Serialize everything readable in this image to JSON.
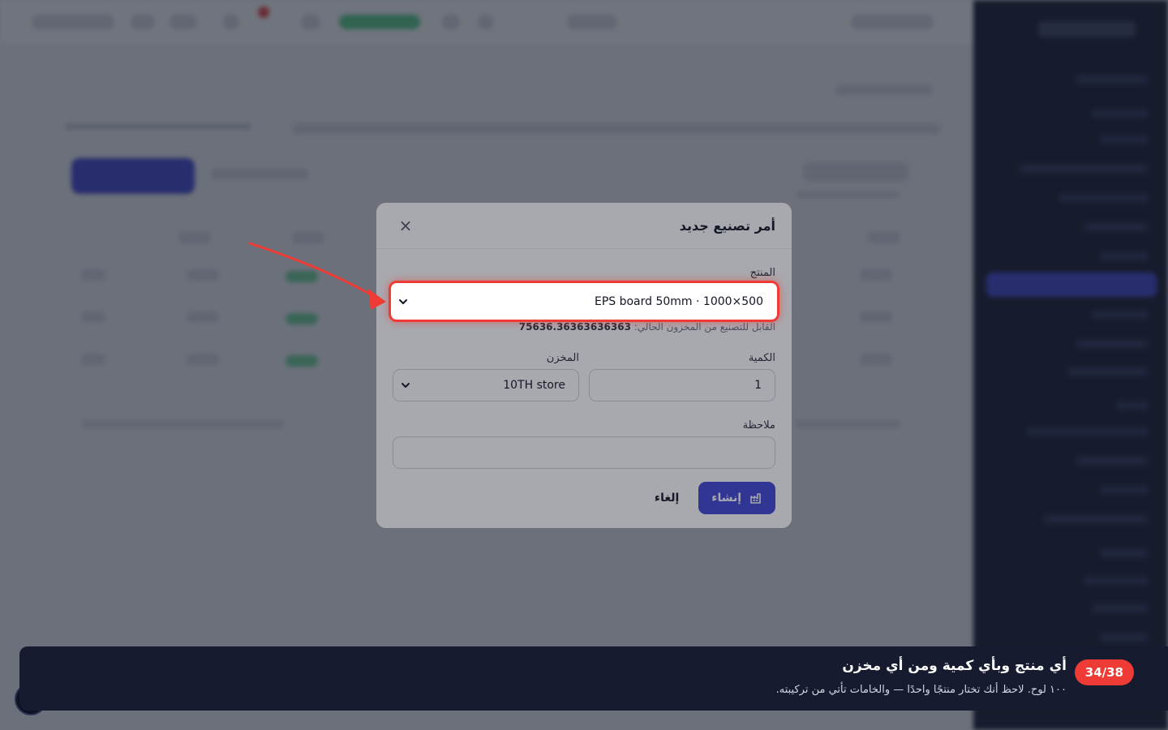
{
  "modal": {
    "title": "أمر تصنيع جديد",
    "close_symbol": "×",
    "product": {
      "label": "المنتج",
      "value": "EPS board 50mm · 1000×500",
      "hint_prefix": "القابل للتصنيع من المخزون الحالي:",
      "hint_value": "75636.36363636363"
    },
    "quantity": {
      "label": "الكمية",
      "value": "1"
    },
    "warehouse": {
      "label": "المخزن",
      "value": "10TH store"
    },
    "note": {
      "label": "ملاحظة",
      "value": ""
    },
    "create_label": "إنشاء",
    "cancel_label": "إلغاء"
  },
  "tour": {
    "step": "34/38",
    "title": "أي منتج وبأي كمية ومن أي مخزن",
    "description": "١٠٠ لوح. لاحظ أنك تختار منتجًا واحدًا — والخامات تأتي من تركيبته."
  },
  "icons": {
    "close": "close-icon",
    "chevron": "chevron-down-icon",
    "factory": "factory-icon",
    "arrow": "annotation-arrow"
  },
  "colors": {
    "accent": "#4046d6",
    "highlight": "#ef3b36",
    "tour_bg": "#161b30",
    "sidebar_bg": "#151a2e"
  }
}
